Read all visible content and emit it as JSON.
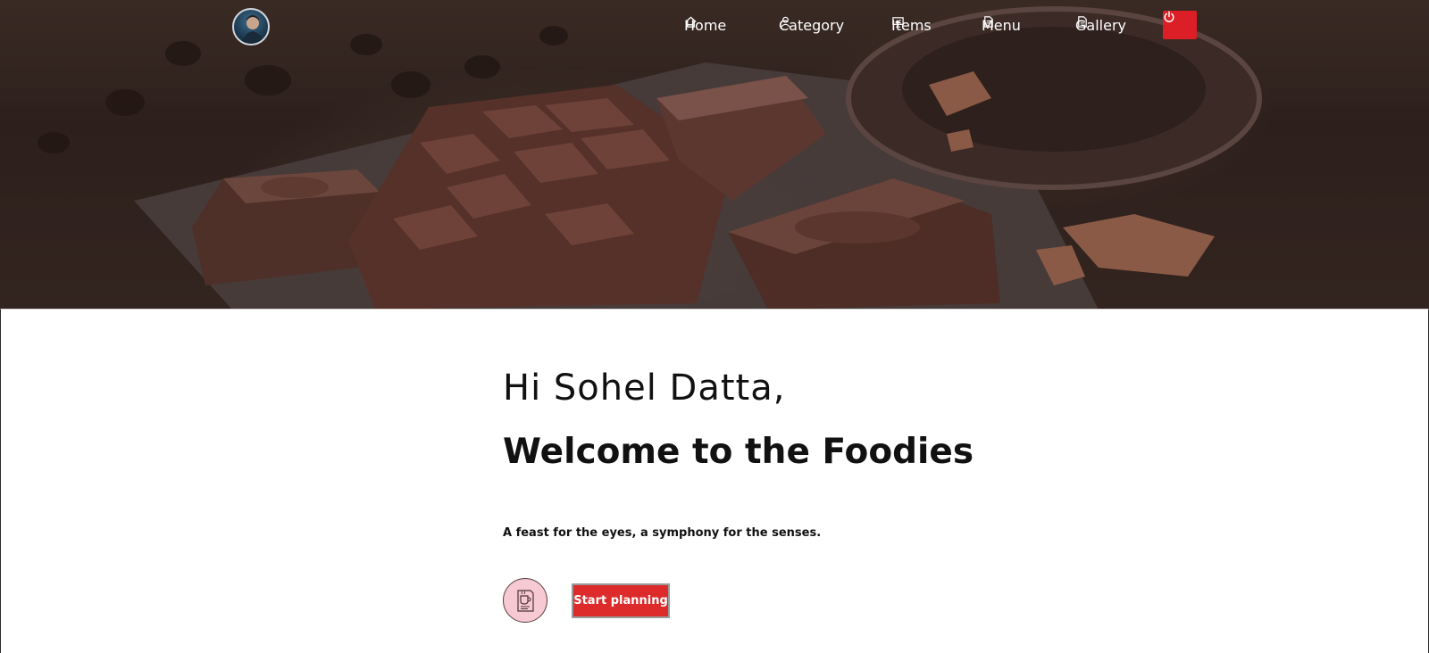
{
  "nav": {
    "items": [
      {
        "label": "Home",
        "icon": "home-icon"
      },
      {
        "label": "Category",
        "icon": "user-icon"
      },
      {
        "label": "Items",
        "icon": "presentation-icon"
      },
      {
        "label": "Menu",
        "icon": "document-icon"
      },
      {
        "label": "Gallery",
        "icon": "document-icon"
      }
    ],
    "power_icon": "power-icon",
    "avatar": "avatar"
  },
  "hero": {
    "greeting": "Hi Sohel Datta,",
    "welcome": "Welcome to the Foodies",
    "tagline": "A feast for the eyes, a symphony for the senses.",
    "cta_label": "Start planning",
    "cta_icon": "coffee-menu-icon"
  },
  "colors": {
    "accent": "#dc1f26",
    "plan_icon_bg": "#f7c9d2",
    "text": "#111111"
  }
}
